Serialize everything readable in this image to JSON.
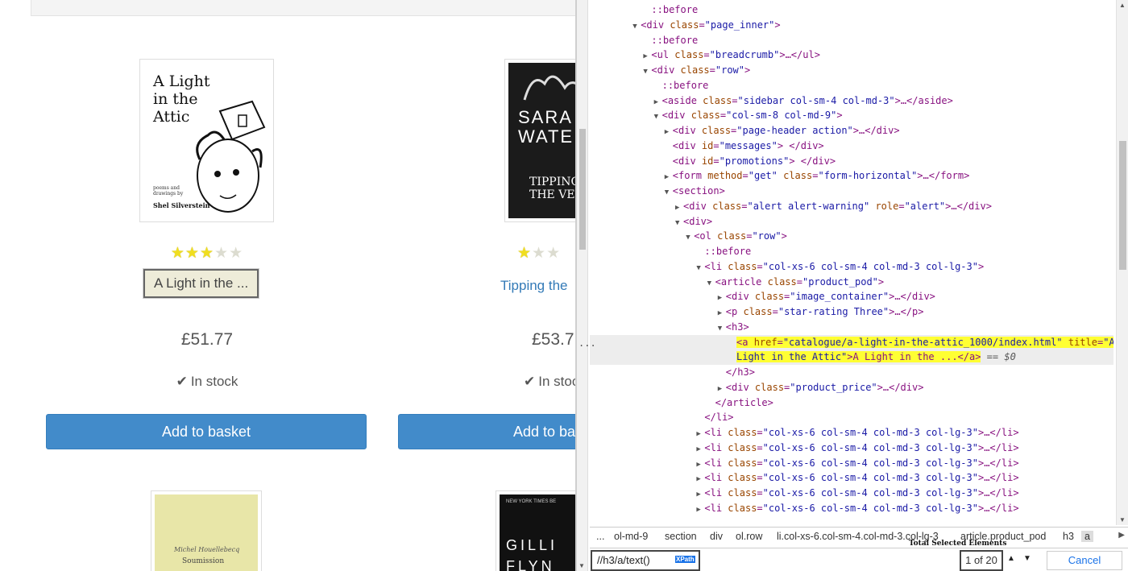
{
  "store": {
    "products": [
      {
        "cover_title_lines": [
          "A Light",
          "in the",
          "Attic"
        ],
        "cover_byline": "poems and drawings by",
        "cover_author": "Shel Silverstein",
        "rating": 3,
        "title": "A Light in the ...",
        "price": "£51.77",
        "stock": "In stock",
        "button": "Add to basket"
      },
      {
        "cover_title_lines": [
          "SARA",
          "WATE"
        ],
        "cover_sub_lines": [
          "TIPPING",
          "THE VEL"
        ],
        "rating": 1,
        "title": "Tipping the",
        "price": "£53.7",
        "stock": "In stoc",
        "button": "Add to ba"
      }
    ],
    "next_row": [
      {
        "cover_author": "Michel Houellebecq",
        "cover_title": "Soumission"
      },
      {
        "cover_top": "NEW YORK TIMES BE",
        "cover_title_lines": [
          "GILLI",
          "FLYN"
        ]
      }
    ]
  },
  "devtools": {
    "colors": {
      "highlight": "#ffff33",
      "tag": "#881280",
      "attr": "#994500",
      "value": "#1a1aa6"
    },
    "dom_lines": [
      {
        "depth": 4,
        "tri": "",
        "html": [
          [
            "p",
            "::before"
          ]
        ]
      },
      {
        "depth": 3,
        "tri": "▼",
        "html": [
          [
            "t",
            "<div "
          ],
          [
            "a",
            "class"
          ],
          [
            "t",
            "="
          ],
          [
            "v",
            "\"page_inner\""
          ],
          [
            "t",
            ">"
          ]
        ]
      },
      {
        "depth": 4,
        "tri": "",
        "html": [
          [
            "p",
            "::before"
          ]
        ]
      },
      {
        "depth": 4,
        "tri": "▶",
        "html": [
          [
            "t",
            "<ul "
          ],
          [
            "a",
            "class"
          ],
          [
            "t",
            "="
          ],
          [
            "v",
            "\"breadcrumb\""
          ],
          [
            "t",
            ">…</ul>"
          ]
        ]
      },
      {
        "depth": 4,
        "tri": "▼",
        "html": [
          [
            "t",
            "<div "
          ],
          [
            "a",
            "class"
          ],
          [
            "t",
            "="
          ],
          [
            "v",
            "\"row\""
          ],
          [
            "t",
            ">"
          ]
        ]
      },
      {
        "depth": 5,
        "tri": "",
        "html": [
          [
            "p",
            "::before"
          ]
        ]
      },
      {
        "depth": 5,
        "tri": "▶",
        "html": [
          [
            "t",
            "<aside "
          ],
          [
            "a",
            "class"
          ],
          [
            "t",
            "="
          ],
          [
            "v",
            "\"sidebar col-sm-4 col-md-3\""
          ],
          [
            "t",
            ">…</aside>"
          ]
        ]
      },
      {
        "depth": 5,
        "tri": "▼",
        "html": [
          [
            "t",
            "<div "
          ],
          [
            "a",
            "class"
          ],
          [
            "t",
            "="
          ],
          [
            "v",
            "\"col-sm-8 col-md-9\""
          ],
          [
            "t",
            ">"
          ]
        ]
      },
      {
        "depth": 6,
        "tri": "▶",
        "html": [
          [
            "t",
            "<div "
          ],
          [
            "a",
            "class"
          ],
          [
            "t",
            "="
          ],
          [
            "v",
            "\"page-header action\""
          ],
          [
            "t",
            ">…</div>"
          ]
        ]
      },
      {
        "depth": 6,
        "tri": "",
        "html": [
          [
            "t",
            "<div "
          ],
          [
            "a",
            "id"
          ],
          [
            "t",
            "="
          ],
          [
            "v",
            "\"messages\""
          ],
          [
            "t",
            "> </div>"
          ]
        ]
      },
      {
        "depth": 6,
        "tri": "",
        "html": [
          [
            "t",
            "<div "
          ],
          [
            "a",
            "id"
          ],
          [
            "t",
            "="
          ],
          [
            "v",
            "\"promotions\""
          ],
          [
            "t",
            "> </div>"
          ]
        ]
      },
      {
        "depth": 6,
        "tri": "▶",
        "html": [
          [
            "t",
            "<form "
          ],
          [
            "a",
            "method"
          ],
          [
            "t",
            "="
          ],
          [
            "v",
            "\"get\""
          ],
          [
            "t",
            " "
          ],
          [
            "a",
            "class"
          ],
          [
            "t",
            "="
          ],
          [
            "v",
            "\"form-horizontal\""
          ],
          [
            "t",
            ">…</form>"
          ]
        ]
      },
      {
        "depth": 6,
        "tri": "▼",
        "html": [
          [
            "t",
            "<section>"
          ]
        ]
      },
      {
        "depth": 7,
        "tri": "▶",
        "html": [
          [
            "t",
            "<div "
          ],
          [
            "a",
            "class"
          ],
          [
            "t",
            "="
          ],
          [
            "v",
            "\"alert alert-warning\""
          ],
          [
            "t",
            " "
          ],
          [
            "a",
            "role"
          ],
          [
            "t",
            "="
          ],
          [
            "v",
            "\"alert\""
          ],
          [
            "t",
            ">…</div>"
          ]
        ]
      },
      {
        "depth": 7,
        "tri": "▼",
        "html": [
          [
            "t",
            "<div>"
          ]
        ]
      },
      {
        "depth": 8,
        "tri": "▼",
        "html": [
          [
            "t",
            "<ol "
          ],
          [
            "a",
            "class"
          ],
          [
            "t",
            "="
          ],
          [
            "v",
            "\"row\""
          ],
          [
            "t",
            ">"
          ]
        ]
      },
      {
        "depth": 9,
        "tri": "",
        "html": [
          [
            "p",
            "::before"
          ]
        ]
      },
      {
        "depth": 9,
        "tri": "▼",
        "html": [
          [
            "t",
            "<li "
          ],
          [
            "a",
            "class"
          ],
          [
            "t",
            "="
          ],
          [
            "v",
            "\"col-xs-6 col-sm-4 col-md-3 col-lg-3\""
          ],
          [
            "t",
            ">"
          ]
        ]
      },
      {
        "depth": 10,
        "tri": "▼",
        "html": [
          [
            "t",
            "<article "
          ],
          [
            "a",
            "class"
          ],
          [
            "t",
            "="
          ],
          [
            "v",
            "\"product_pod\""
          ],
          [
            "t",
            ">"
          ]
        ]
      },
      {
        "depth": 11,
        "tri": "▶",
        "html": [
          [
            "t",
            "<div "
          ],
          [
            "a",
            "class"
          ],
          [
            "t",
            "="
          ],
          [
            "v",
            "\"image_container\""
          ],
          [
            "t",
            ">…</div>"
          ]
        ]
      },
      {
        "depth": 11,
        "tri": "▶",
        "html": [
          [
            "t",
            "<p "
          ],
          [
            "a",
            "class"
          ],
          [
            "t",
            "="
          ],
          [
            "v",
            "\"star-rating Three\""
          ],
          [
            "t",
            ">…</p>"
          ]
        ]
      },
      {
        "depth": 11,
        "tri": "▼",
        "html": [
          [
            "t",
            "<h3>"
          ]
        ]
      },
      {
        "depth": 12,
        "tri": "",
        "selected": true,
        "hl": true,
        "html": [
          [
            "t",
            "<a "
          ],
          [
            "a",
            "href"
          ],
          [
            "t",
            "="
          ],
          [
            "v",
            "\"catalogue/a-light-in-the-attic_1000/index.html\""
          ],
          [
            "t",
            " "
          ],
          [
            "a",
            "title"
          ],
          [
            "t",
            "="
          ],
          [
            "v",
            "\"A"
          ]
        ]
      },
      {
        "depth": 12,
        "tri": "",
        "selected": true,
        "hl": true,
        "html": [
          [
            "v",
            "Light in the Attic\""
          ],
          [
            "t",
            ">A Light in the ...</a>"
          ]
        ],
        "suffix": " == $0"
      },
      {
        "depth": 11,
        "tri": "",
        "html": [
          [
            "t",
            "</h3>"
          ]
        ]
      },
      {
        "depth": 11,
        "tri": "▶",
        "html": [
          [
            "t",
            "<div "
          ],
          [
            "a",
            "class"
          ],
          [
            "t",
            "="
          ],
          [
            "v",
            "\"product_price\""
          ],
          [
            "t",
            ">…</div>"
          ]
        ]
      },
      {
        "depth": 10,
        "tri": "",
        "html": [
          [
            "t",
            "</article>"
          ]
        ]
      },
      {
        "depth": 9,
        "tri": "",
        "html": [
          [
            "t",
            "</li>"
          ]
        ]
      },
      {
        "depth": 9,
        "tri": "▶",
        "html": [
          [
            "t",
            "<li "
          ],
          [
            "a",
            "class"
          ],
          [
            "t",
            "="
          ],
          [
            "v",
            "\"col-xs-6 col-sm-4 col-md-3 col-lg-3\""
          ],
          [
            "t",
            ">…</li>"
          ]
        ]
      },
      {
        "depth": 9,
        "tri": "▶",
        "html": [
          [
            "t",
            "<li "
          ],
          [
            "a",
            "class"
          ],
          [
            "t",
            "="
          ],
          [
            "v",
            "\"col-xs-6 col-sm-4 col-md-3 col-lg-3\""
          ],
          [
            "t",
            ">…</li>"
          ]
        ]
      },
      {
        "depth": 9,
        "tri": "▶",
        "html": [
          [
            "t",
            "<li "
          ],
          [
            "a",
            "class"
          ],
          [
            "t",
            "="
          ],
          [
            "v",
            "\"col-xs-6 col-sm-4 col-md-3 col-lg-3\""
          ],
          [
            "t",
            ">…</li>"
          ]
        ]
      },
      {
        "depth": 9,
        "tri": "▶",
        "html": [
          [
            "t",
            "<li "
          ],
          [
            "a",
            "class"
          ],
          [
            "t",
            "="
          ],
          [
            "v",
            "\"col-xs-6 col-sm-4 col-md-3 col-lg-3\""
          ],
          [
            "t",
            ">…</li>"
          ]
        ]
      },
      {
        "depth": 9,
        "tri": "▶",
        "html": [
          [
            "t",
            "<li "
          ],
          [
            "a",
            "class"
          ],
          [
            "t",
            "="
          ],
          [
            "v",
            "\"col-xs-6 col-sm-4 col-md-3 col-lg-3\""
          ],
          [
            "t",
            ">…</li>"
          ]
        ]
      },
      {
        "depth": 9,
        "tri": "▶",
        "html": [
          [
            "t",
            "<li "
          ],
          [
            "a",
            "class"
          ],
          [
            "t",
            "="
          ],
          [
            "v",
            "\"col-xs-6 col-sm-4 col-md-3 col-lg-3\""
          ],
          [
            "t",
            ">…</li>"
          ]
        ]
      }
    ],
    "selected_dots": "...",
    "breadcrumbs": [
      "...",
      "ol-md-9",
      "section",
      "div",
      "ol.row",
      "li.col-xs-6.col-sm-4.col-md-3.col-lg-3",
      "article.product_pod",
      "h3",
      "a"
    ],
    "search": {
      "xpath_value": "//h3/a/text()",
      "xpath_badge": "XPath",
      "total_label": "Total Selected Elements",
      "count": "1 of 20",
      "prev": "▲",
      "next": "▼",
      "cancel": "Cancel"
    }
  }
}
